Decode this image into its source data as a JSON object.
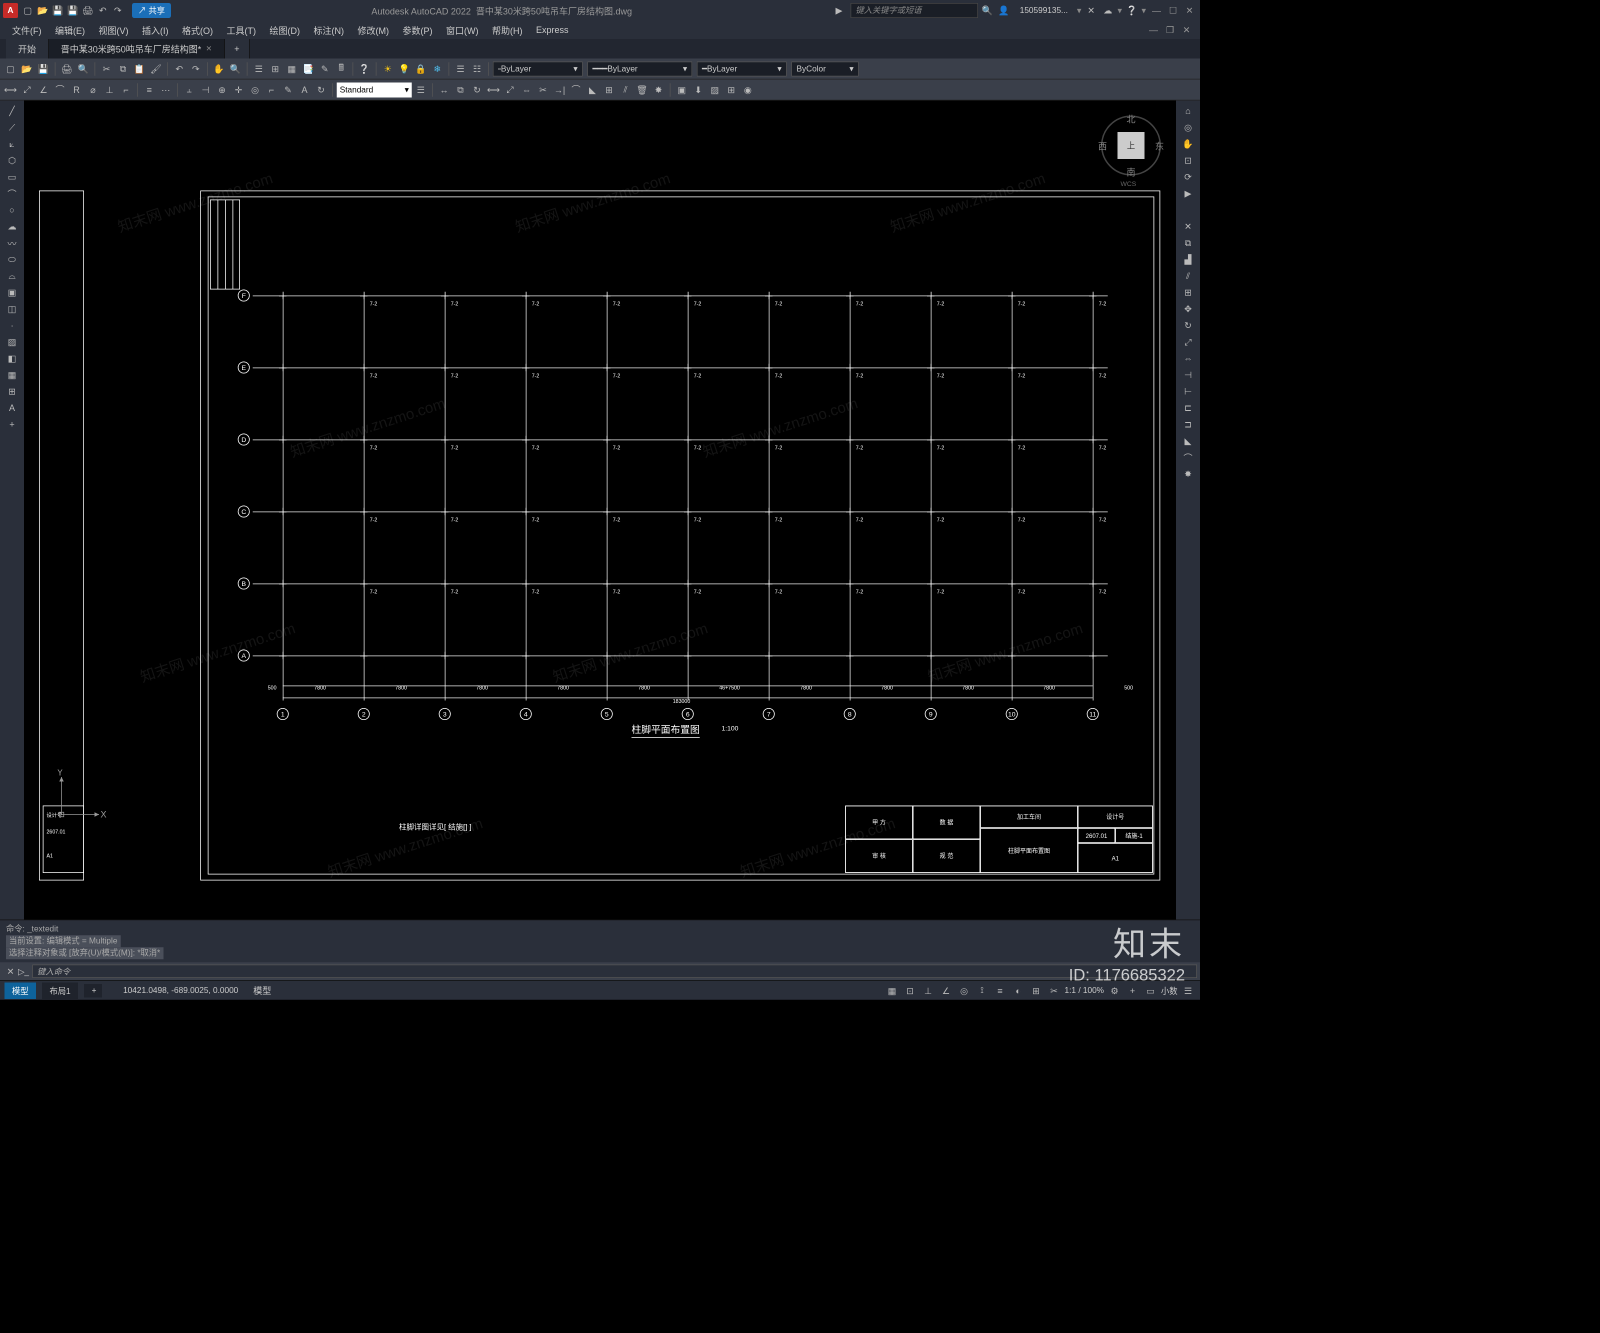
{
  "app": {
    "product": "Autodesk AutoCAD 2022",
    "filename": "晋中某30米跨50吨吊车厂房结构图.dwg",
    "search_placeholder": "键入关键字或短语",
    "user": "150599135...",
    "logo_letter": "A"
  },
  "share_label": "共享",
  "menus": [
    "文件(F)",
    "编辑(E)",
    "视图(V)",
    "插入(I)",
    "格式(O)",
    "工具(T)",
    "绘图(D)",
    "标注(N)",
    "修改(M)",
    "参数(P)",
    "窗口(W)",
    "帮助(H)",
    "Express"
  ],
  "tabs": {
    "start": "开始",
    "file": "晋中某30米跨50吨吊车厂房结构图*"
  },
  "layer_props": {
    "layer": "ByLayer",
    "linetype": "ByLayer",
    "lineweight": "ByLayer",
    "color": "ByColor"
  },
  "text_style": "Standard",
  "viewcube": {
    "face": "上",
    "n": "北",
    "s": "南",
    "e": "东",
    "w": "西",
    "wcs": "WCS"
  },
  "ucs": {
    "x": "X",
    "y": "Y"
  },
  "drawing": {
    "title": "柱脚平面布置图",
    "scale": "1:100",
    "note": "柱脚详图详见[ 结施[] ]",
    "row_labels": [
      "A",
      "B",
      "C",
      "D",
      "E",
      "F"
    ],
    "col_labels": [
      "1",
      "2",
      "3",
      "4",
      "5",
      "6",
      "7",
      "8",
      "9",
      "10",
      "11"
    ],
    "dim_cols": [
      "500",
      "7800",
      "7800",
      "7800",
      "7800",
      "7800",
      "46+7500",
      "7800",
      "7800",
      "7800",
      "7800",
      "500"
    ],
    "dim_total": "183000",
    "annot": "7-2",
    "title_block": {
      "proj_label": "加工车间",
      "design_label": "设计号",
      "sheet_label": "柱脚平面布置图",
      "stage_l": "甲 方",
      "stage_v": "数 据",
      "chk_l": "审 核",
      "chk_v": "规 范",
      "dno": "2607.01",
      "sheet_no": "结施-1",
      "size": "A1"
    }
  },
  "left_title_block": {
    "design": "设计号",
    "dno": "2607.01",
    "size": "A1"
  },
  "command": {
    "hist1": "命令: _textedit",
    "hist2": "当前设置: 编辑模式 = Multiple",
    "hist3": "选择注释对象或 [放弃(U)/模式(M)]: *取消*",
    "prompt": "键入命令"
  },
  "status": {
    "model_tab": "模型",
    "layout_tab": "布局1",
    "coords": "10421.0498, -689.0025, 0.0000",
    "mode": "模型",
    "scale": "1:1 / 100%",
    "decimal": "小数"
  },
  "watermark": {
    "brand": "知末",
    "url": "知末网 www.znzmo.com",
    "id": "ID: 1176685322"
  }
}
